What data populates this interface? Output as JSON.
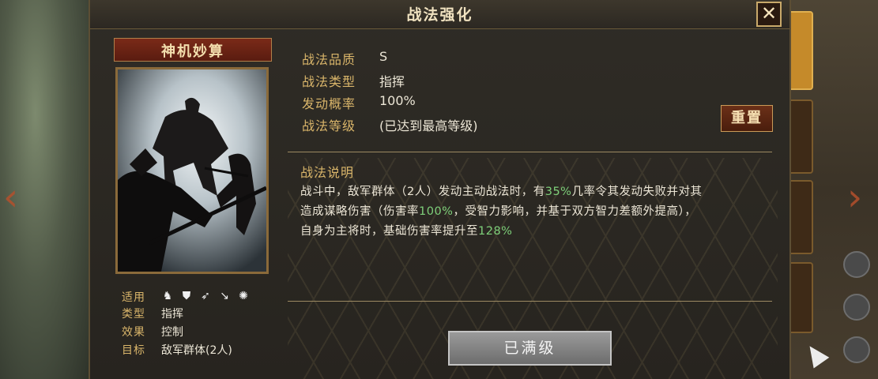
{
  "title": "战法强化",
  "skill_name": "神机妙算",
  "stats": [
    {
      "label": "战法品质",
      "value": "S"
    },
    {
      "label": "战法类型",
      "value": "指挥"
    },
    {
      "label": "发动概率",
      "value": "100%"
    },
    {
      "label": "战法等级",
      "value": "(已达到最高等级)"
    }
  ],
  "reset_label": "重置",
  "description": {
    "title": "战法说明",
    "line1_a": "战斗中，敌军群体（2人）发动主动战法时，有",
    "line1_hl": "35%",
    "line1_b": "几率令其发动失败并对其",
    "line2_a": "造成谋略伤害（伤害率",
    "line2_hl": "100%",
    "line2_b": "，受智力影响，并基于双方智力差额外提高），",
    "line3_a": "自身为主将时，基础伤害率提升至",
    "line3_hl": "128%"
  },
  "info": {
    "apply_label": "适用",
    "apply_icons": [
      "cavalry-icon",
      "shield-icon",
      "bow-icon",
      "spear-icon",
      "wheel-icon"
    ],
    "type_label": "类型",
    "type_value": "指挥",
    "effect_label": "效果",
    "effect_value": "控制",
    "target_label": "目标",
    "target_value": "敌军群体(2人)"
  },
  "maxed_label": "已满级",
  "colors": {
    "gold_label": "#d9b56a",
    "highlight": "#7ed07a",
    "accent_red": "#6b3018"
  }
}
